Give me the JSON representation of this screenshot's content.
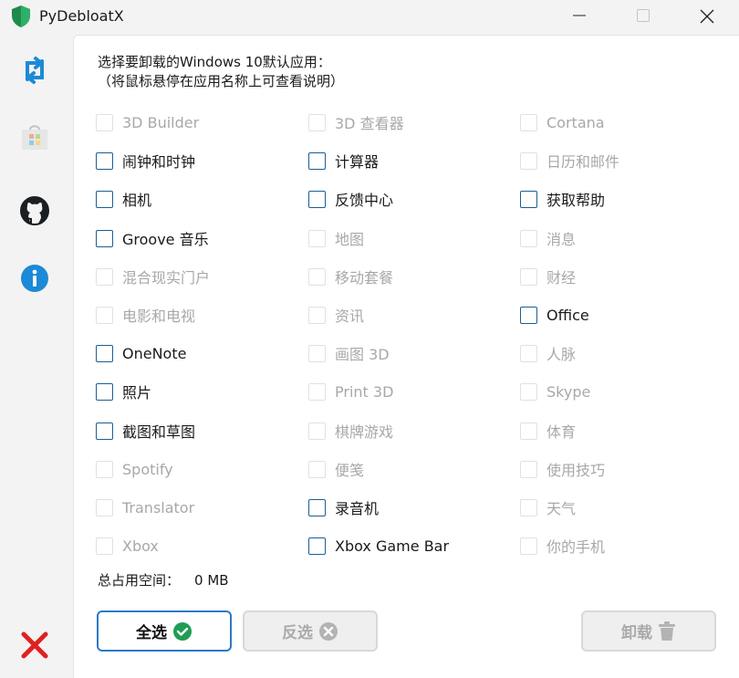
{
  "window": {
    "title": "PyDebloatX"
  },
  "header": {
    "line1": "选择要卸载的Windows 10默认应用：",
    "line2": "（将鼠标悬停在应用名称上可查看说明）"
  },
  "apps": [
    {
      "label": "3D Builder",
      "enabled": false
    },
    {
      "label": "3D 查看器",
      "enabled": false
    },
    {
      "label": "Cortana",
      "enabled": false
    },
    {
      "label": "闹钟和时钟",
      "enabled": true
    },
    {
      "label": "计算器",
      "enabled": true
    },
    {
      "label": "日历和邮件",
      "enabled": false
    },
    {
      "label": "相机",
      "enabled": true
    },
    {
      "label": "反馈中心",
      "enabled": true
    },
    {
      "label": "获取帮助",
      "enabled": true
    },
    {
      "label": "Groove 音乐",
      "enabled": true
    },
    {
      "label": "地图",
      "enabled": false
    },
    {
      "label": "消息",
      "enabled": false
    },
    {
      "label": "混合现实门户",
      "enabled": false
    },
    {
      "label": "移动套餐",
      "enabled": false
    },
    {
      "label": "财经",
      "enabled": false
    },
    {
      "label": "电影和电视",
      "enabled": false
    },
    {
      "label": "资讯",
      "enabled": false
    },
    {
      "label": "Office",
      "enabled": true
    },
    {
      "label": "OneNote",
      "enabled": true
    },
    {
      "label": "画图 3D",
      "enabled": false
    },
    {
      "label": "人脉",
      "enabled": false
    },
    {
      "label": "照片",
      "enabled": true
    },
    {
      "label": "Print 3D",
      "enabled": false
    },
    {
      "label": "Skype",
      "enabled": false
    },
    {
      "label": "截图和草图",
      "enabled": true
    },
    {
      "label": "棋牌游戏",
      "enabled": false
    },
    {
      "label": "体育",
      "enabled": false
    },
    {
      "label": "Spotify",
      "enabled": false
    },
    {
      "label": "便笺",
      "enabled": false
    },
    {
      "label": "使用技巧",
      "enabled": false
    },
    {
      "label": "Translator",
      "enabled": false
    },
    {
      "label": "录音机",
      "enabled": true
    },
    {
      "label": "天气",
      "enabled": false
    },
    {
      "label": "Xbox",
      "enabled": false
    },
    {
      "label": "Xbox Game Bar",
      "enabled": true
    },
    {
      "label": "你的手机",
      "enabled": false
    }
  ],
  "summary": {
    "label": "总占用空间：",
    "value": "0 MB"
  },
  "buttons": {
    "select_all": "全选",
    "invert": "反选",
    "uninstall": "卸载"
  },
  "sidebar": {
    "items": [
      "refresh-icon",
      "store-icon",
      "github-icon",
      "info-icon",
      "exit-icon"
    ]
  },
  "colors": {
    "accent": "#2b7ac4",
    "checkbox_border": "#1c5e92",
    "disabled_text": "#a8a8a8",
    "success_green": "#1f9d55",
    "danger_red": "#e02020"
  }
}
